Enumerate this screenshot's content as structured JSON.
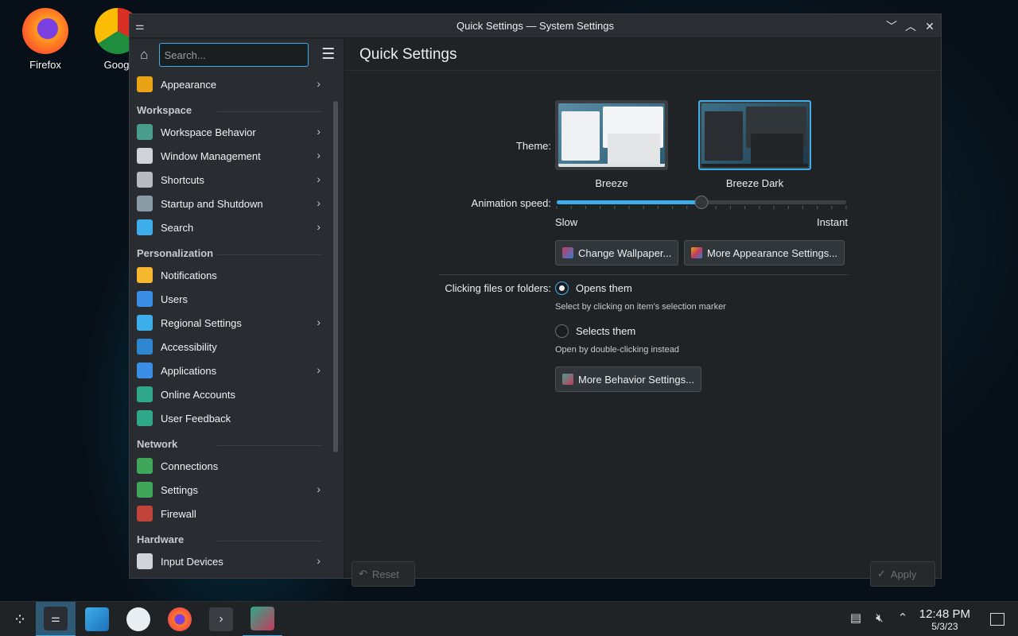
{
  "desktop": {
    "icons": [
      {
        "label": "Firefox"
      },
      {
        "label": "Googl"
      }
    ]
  },
  "window": {
    "title": "Quick Settings — System Settings",
    "controls": {
      "minimize": "﹀",
      "maximize": "︿",
      "close": "✕"
    }
  },
  "sidebar": {
    "search_placeholder": "Search...",
    "items": [
      {
        "label": "Appearance",
        "icon": "appearance-icon",
        "color": "#e8a317",
        "chevron": true
      },
      {
        "header": "Workspace"
      },
      {
        "label": "Workspace Behavior",
        "icon": "workspace-icon",
        "color": "#4a9c8c",
        "chevron": true
      },
      {
        "label": "Window Management",
        "icon": "window-icon",
        "color": "#d0d4d8",
        "chevron": true
      },
      {
        "label": "Shortcuts",
        "icon": "keyboard-icon",
        "color": "#b8bcc0",
        "chevron": true
      },
      {
        "label": "Startup and Shutdown",
        "icon": "startup-icon",
        "color": "#8a9ba8",
        "chevron": true
      },
      {
        "label": "Search",
        "icon": "search-icon",
        "color": "#3daee9",
        "chevron": true
      },
      {
        "header": "Personalization"
      },
      {
        "label": "Notifications",
        "icon": "bell-icon",
        "color": "#f5b82e",
        "chevron": false
      },
      {
        "label": "Users",
        "icon": "users-icon",
        "color": "#3a8ee6",
        "chevron": false
      },
      {
        "label": "Regional Settings",
        "icon": "regional-icon",
        "color": "#3daee9",
        "chevron": true
      },
      {
        "label": "Accessibility",
        "icon": "accessibility-icon",
        "color": "#2f86d1",
        "chevron": false
      },
      {
        "label": "Applications",
        "icon": "applications-icon",
        "color": "#3a8ee6",
        "chevron": true
      },
      {
        "label": "Online Accounts",
        "icon": "online-accounts-icon",
        "color": "#2fa889",
        "chevron": false
      },
      {
        "label": "User Feedback",
        "icon": "feedback-icon",
        "color": "#2fa889",
        "chevron": false
      },
      {
        "header": "Network"
      },
      {
        "label": "Connections",
        "icon": "globe-icon",
        "color": "#3fa65a",
        "chevron": false
      },
      {
        "label": "Settings",
        "icon": "globe-icon",
        "color": "#3fa65a",
        "chevron": true
      },
      {
        "label": "Firewall",
        "icon": "firewall-icon",
        "color": "#c0443a",
        "chevron": false
      },
      {
        "header": "Hardware"
      },
      {
        "label": "Input Devices",
        "icon": "mouse-icon",
        "color": "#d0d4d8",
        "chevron": true
      }
    ]
  },
  "content": {
    "page_title": "Quick Settings",
    "theme_label": "Theme:",
    "themes": [
      {
        "name": "Breeze",
        "selected": false
      },
      {
        "name": "Breeze Dark",
        "selected": true
      }
    ],
    "animation_label": "Animation speed:",
    "slider": {
      "min_label": "Slow",
      "max_label": "Instant",
      "value_fraction": 0.5
    },
    "change_wallpaper_button": "Change Wallpaper...",
    "more_appearance_button": "More Appearance Settings...",
    "clicking_label": "Clicking files or folders:",
    "opens_them": "Opens them",
    "opens_them_hint": "Select by clicking on item's selection marker",
    "selects_them": "Selects them",
    "selects_them_hint": "Open by double-clicking instead",
    "more_behavior_button": "More Behavior Settings...",
    "reset_button": "Reset",
    "apply_button": "Apply"
  },
  "taskbar": {
    "clock_time": "12:48 PM",
    "clock_date": "5/3/23"
  },
  "colors": {
    "accent": "#3daee9",
    "window_bg": "#202326",
    "sidebar_bg": "#292c30"
  }
}
